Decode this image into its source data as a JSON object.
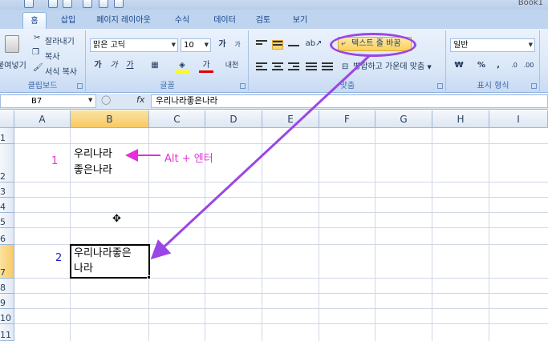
{
  "app": {
    "title": "Book1"
  },
  "tabs": [
    {
      "label": "홈"
    },
    {
      "label": "삽입"
    },
    {
      "label": "페이지 레이아웃"
    },
    {
      "label": "수식"
    },
    {
      "label": "데이터"
    },
    {
      "label": "검토"
    },
    {
      "label": "보기"
    }
  ],
  "clipboard": {
    "paste_label": "붙여넣기",
    "cut_label": "잘라내기",
    "copy_label": "복사",
    "format_painter_label": "서식 복사",
    "group_label": "클립보드"
  },
  "font": {
    "font_name": "맑은 고딕",
    "font_size": "10",
    "bold_label": "가",
    "italic_label": "가",
    "underline_label": "가",
    "font_color_label": "가",
    "phonetic_label": "내천",
    "group_label": "글꼴"
  },
  "alignment": {
    "wrap_text_label": "텍스트 줄 바꿈",
    "merge_center_label": "병합하고 가운데 맞춤",
    "group_label": "맞춤"
  },
  "number": {
    "format": "일반",
    "currency_label": "₩",
    "percent_label": "%",
    "comma_label": ",",
    "group_label": "표시 형식"
  },
  "formula_bar": {
    "name_box": "B7",
    "fx_label": "fx",
    "formula": "우리나라좋은나라"
  },
  "columns": [
    "A",
    "B",
    "C",
    "D",
    "E",
    "F",
    "G",
    "H",
    "I"
  ],
  "selected_column": "B",
  "rows": [
    "1",
    "2",
    "3",
    "4",
    "5",
    "6",
    "7",
    "8",
    "9",
    "10",
    "11"
  ],
  "selected_row": "7",
  "cells": {
    "b2_line1": "우리나라",
    "b2_line2": "좋은나라",
    "b7_line1": "우리나라좋은",
    "b7_line2": "나라"
  },
  "annotations": {
    "label_1": "1",
    "label_2": "2",
    "alt_enter": "Alt + 엔터"
  },
  "colors": {
    "annotation_magenta": "#e52fd8",
    "annotation_blue": "#1a24c8",
    "arrow_purple": "#9a46e6"
  }
}
